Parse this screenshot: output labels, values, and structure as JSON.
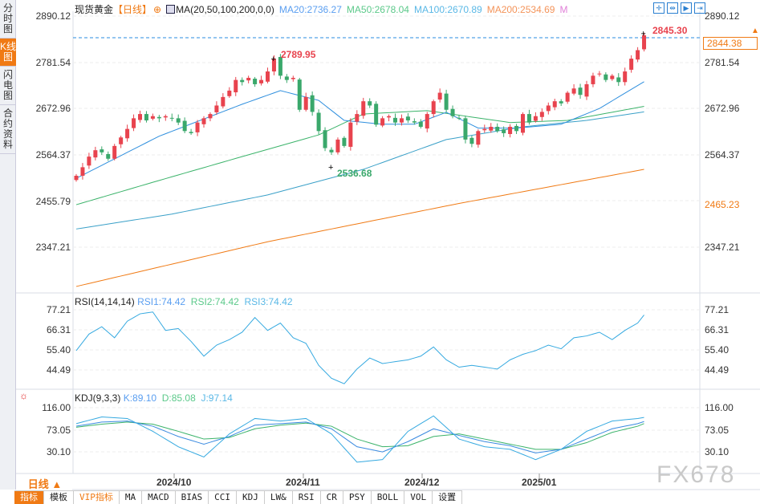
{
  "sidebar": {
    "tabs": [
      {
        "label": "分时图"
      },
      {
        "label": "K线图",
        "active": true
      },
      {
        "label": "闪电图"
      },
      {
        "label": "合约资料"
      }
    ]
  },
  "header": {
    "title": "现货黄金",
    "period_tag": "【日线】",
    "ma_label": "MA(20,50,100,200,0,0)",
    "ma20": "MA20:2736.27",
    "ma50": "MA50:2678.04",
    "ma100": "MA100:2670.89",
    "ma200": "MA200:2534.69",
    "m": "M"
  },
  "colors": {
    "up": "#e8434e",
    "down": "#3aa86b",
    "ma20": "#2f8fde",
    "ma50": "#3bb36a",
    "ma100": "#3aa0c8",
    "ma200": "#f07a14",
    "rsi": "#35a9e0",
    "k": "#3a8ae0",
    "d": "#3bb36a",
    "j": "#35a9e0",
    "accent": "#f07a14"
  },
  "toolbar": {
    "icons": [
      "crosshair-icon",
      "zoom-range-icon",
      "play-icon",
      "goto-end-icon"
    ]
  },
  "price_axis": {
    "labels": [
      "2890.12",
      "2781.54",
      "2672.96",
      "2564.37",
      "2347.21"
    ],
    "current": "2844.38",
    "marker": "2465.23"
  },
  "annotations": {
    "high": "2789.95",
    "low": "2536.68",
    "last": "2845.30"
  },
  "rsi_panel": {
    "label": "RSI(14,14,14)",
    "rsi1": "RSI1:74.42",
    "rsi2": "RSI2:74.42",
    "rsi3": "RSI3:74.42",
    "axis": [
      "77.21",
      "66.31",
      "55.40",
      "44.49"
    ]
  },
  "kdj_panel": {
    "label": "KDJ(9,3,3)",
    "k": "K:89.10",
    "d": "D:85.08",
    "j": "J:97.14",
    "axis": [
      "116.00",
      "73.05",
      "30.10"
    ]
  },
  "x_axis": {
    "period": "日线 ▲",
    "dates": [
      "2024/10",
      "2024/11",
      "2024/12",
      "2025/01"
    ]
  },
  "bottom_tabs": [
    "指标",
    "模板",
    "VIP指标",
    "MA",
    "MACD",
    "BIAS",
    "CCI",
    "KDJ",
    "LW&",
    "RSI",
    "CR",
    "PSY",
    "BOLL",
    "VOL",
    "设置"
  ],
  "watermark": "FX678",
  "chart_data": {
    "type": "candlestick",
    "closes": [
      2515,
      2535,
      2560,
      2575,
      2570,
      2555,
      2585,
      2605,
      2625,
      2650,
      2660,
      2645,
      2655,
      2650,
      2655,
      2650,
      2640,
      2620,
      2615,
      2640,
      2650,
      2660,
      2680,
      2700,
      2715,
      2740,
      2735,
      2745,
      2730,
      2740,
      2760,
      2790,
      2750,
      2740,
      2745,
      2670,
      2700,
      2665,
      2620,
      2580,
      2570,
      2600,
      2585,
      2640,
      2660,
      2690,
      2680,
      2635,
      2650,
      2655,
      2640,
      2650,
      2645,
      2640,
      2630,
      2660,
      2690,
      2710,
      2670,
      2655,
      2650,
      2600,
      2590,
      2620,
      2625,
      2630,
      2620,
      2615,
      2630,
      2620,
      2660,
      2640,
      2655,
      2665,
      2680,
      2690,
      2685,
      2710,
      2720,
      2705,
      2730,
      2750,
      2755,
      2740,
      2750,
      2735,
      2760,
      2790,
      2810,
      2845
    ],
    "ma20": [
      [
        0,
        2509
      ],
      [
        13,
        2608
      ],
      [
        26,
        2683
      ],
      [
        32,
        2715
      ],
      [
        38,
        2692
      ],
      [
        42,
        2645
      ],
      [
        48,
        2636
      ],
      [
        53,
        2636
      ],
      [
        58,
        2664
      ],
      [
        63,
        2627
      ],
      [
        69,
        2627
      ],
      [
        76,
        2636
      ],
      [
        82,
        2673
      ],
      [
        89,
        2736
      ]
    ],
    "ma50": [
      [
        0,
        2447
      ],
      [
        13,
        2504
      ],
      [
        26,
        2560
      ],
      [
        38,
        2611
      ],
      [
        45,
        2660
      ],
      [
        55,
        2668
      ],
      [
        68,
        2640
      ],
      [
        77,
        2645
      ],
      [
        89,
        2678
      ]
    ],
    "ma100": [
      [
        0,
        2390
      ],
      [
        15,
        2425
      ],
      [
        30,
        2470
      ],
      [
        45,
        2530
      ],
      [
        58,
        2600
      ],
      [
        70,
        2630
      ],
      [
        80,
        2645
      ],
      [
        89,
        2665
      ]
    ],
    "ma200": [
      [
        0,
        2255
      ],
      [
        30,
        2360
      ],
      [
        60,
        2450
      ],
      [
        89,
        2530
      ]
    ],
    "rsi": [
      [
        0,
        55
      ],
      [
        2,
        64
      ],
      [
        4,
        68
      ],
      [
        6,
        62
      ],
      [
        8,
        71
      ],
      [
        10,
        75
      ],
      [
        12,
        76
      ],
      [
        14,
        66
      ],
      [
        16,
        67
      ],
      [
        18,
        60
      ],
      [
        20,
        52
      ],
      [
        22,
        58
      ],
      [
        24,
        61
      ],
      [
        26,
        65
      ],
      [
        28,
        73
      ],
      [
        30,
        66
      ],
      [
        32,
        70
      ],
      [
        34,
        62
      ],
      [
        36,
        59
      ],
      [
        38,
        47
      ],
      [
        40,
        40
      ],
      [
        42,
        37
      ],
      [
        44,
        45
      ],
      [
        46,
        51
      ],
      [
        48,
        48
      ],
      [
        50,
        49
      ],
      [
        52,
        50
      ],
      [
        54,
        52
      ],
      [
        56,
        57
      ],
      [
        58,
        50
      ],
      [
        60,
        46
      ],
      [
        62,
        47
      ],
      [
        64,
        46
      ],
      [
        66,
        45
      ],
      [
        68,
        50
      ],
      [
        70,
        53
      ],
      [
        72,
        55
      ],
      [
        74,
        58
      ],
      [
        76,
        56
      ],
      [
        78,
        62
      ],
      [
        80,
        63
      ],
      [
        82,
        65
      ],
      [
        84,
        61
      ],
      [
        86,
        66
      ],
      [
        88,
        70
      ],
      [
        89,
        74.42
      ]
    ],
    "k": [
      80,
      88,
      90,
      80,
      60,
      45,
      60,
      82,
      85,
      88,
      75,
      40,
      30,
      50,
      75,
      62,
      50,
      42,
      28,
      35,
      55,
      75,
      85,
      89.1
    ],
    "d": [
      78,
      84,
      88,
      84,
      70,
      55,
      58,
      75,
      82,
      86,
      80,
      55,
      40,
      42,
      60,
      65,
      55,
      45,
      35,
      35,
      48,
      68,
      80,
      85.08
    ],
    "j": [
      85,
      98,
      95,
      70,
      40,
      20,
      65,
      95,
      90,
      95,
      65,
      10,
      15,
      70,
      100,
      55,
      40,
      35,
      15,
      35,
      70,
      90,
      95,
      97.14
    ]
  }
}
